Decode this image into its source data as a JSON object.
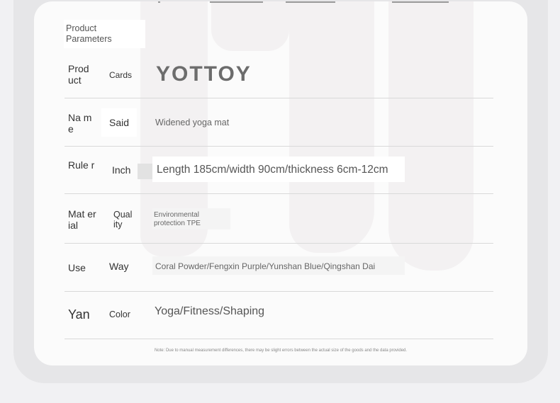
{
  "title": "Product Parameters",
  "brand_logo": "YOTTOY",
  "rows": [
    {
      "key_a": "Prod uct",
      "key_b": "Cards",
      "value": ""
    },
    {
      "key_a": "Na me",
      "key_b": "Said",
      "value": "Widened yoga mat"
    },
    {
      "key_a": "Rule r",
      "key_b": "Inch",
      "value": "Length 185cm/width 90cm/thickness 6cm-12cm"
    },
    {
      "key_a": "Mat erial",
      "key_b": "Qual ity",
      "value": "Environmental protection TPE"
    },
    {
      "key_a": "Use",
      "key_b": "Way",
      "value": "Coral Powder/Fengxin Purple/Yunshan Blue/Qingshan Dai"
    },
    {
      "key_a": "Yan",
      "key_b": "Color",
      "value": "Yoga/Fitness/Shaping"
    }
  ],
  "footnote": "Note: Due to manual measurement differences, there may be slight errors between the actual size of the goods and the data provided."
}
